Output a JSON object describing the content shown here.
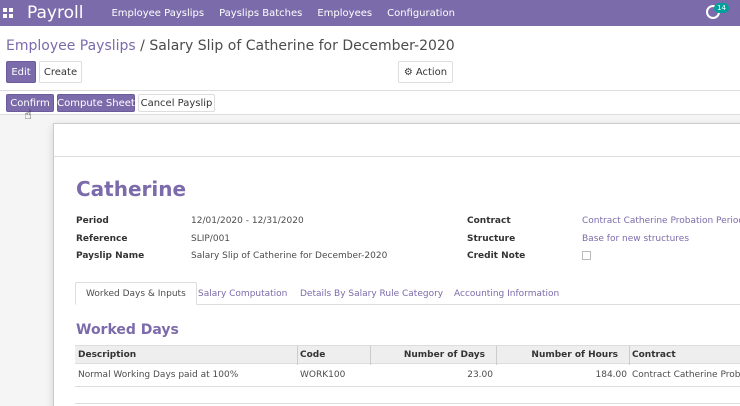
{
  "navbar": {
    "brand": "Payroll",
    "menu": [
      "Employee Payslips",
      "Payslips Batches",
      "Employees",
      "Configuration"
    ],
    "chat_badge": "14",
    "bg_color": "#7c6bab"
  },
  "breadcrumb": {
    "parent": "Employee Payslips",
    "separator": " / ",
    "current": "Salary Slip of Catherine for December-2020"
  },
  "buttons": {
    "edit": "Edit",
    "create": "Create",
    "action": "Action",
    "confirm": "Confirm",
    "compute_sheet": "Compute Sheet",
    "cancel_payslip": "Cancel Payslip"
  },
  "form": {
    "employee_name": "Catherine",
    "left_fields": [
      {
        "label": "Period",
        "value": "12/01/2020 - 12/31/2020"
      },
      {
        "label": "Reference",
        "value": "SLIP/001"
      },
      {
        "label": "Payslip Name",
        "value": "Salary Slip of Catherine for December-2020"
      }
    ],
    "right_fields": [
      {
        "label": "Contract",
        "value": "Contract Catherine Probation Period"
      },
      {
        "label": "Structure",
        "value": "Base for new structures"
      },
      {
        "label": "Credit Note",
        "value": ""
      }
    ],
    "credit_note_checked": false
  },
  "tabs": [
    "Worked Days & Inputs",
    "Salary Computation",
    "Details By Salary Rule Category",
    "Accounting Information"
  ],
  "worked_days": {
    "title": "Worked Days",
    "columns": [
      "Description",
      "Code",
      "Number of Days",
      "Number of Hours",
      "Contract"
    ],
    "rows": [
      {
        "description": "Normal Working Days paid at 100%",
        "code": "WORK100",
        "days": "23.00",
        "hours": "184.00",
        "contract": "Contract Catherine Probat"
      }
    ]
  }
}
